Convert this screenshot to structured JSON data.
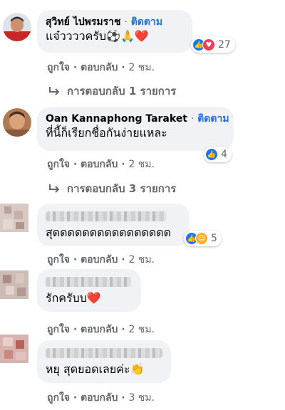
{
  "comments": [
    {
      "name": "สุวิทย์ ไปพรมราช",
      "follow": "ติดตาม",
      "text": "แจ๋ววววครับ⚽🙏❤️",
      "reactions": [
        "like",
        "love"
      ],
      "reaction_count": "27",
      "like_label": "ถูกใจ",
      "reply_label": "ตอบกลับ",
      "time": "2 ชม.",
      "replies_label": "การตอบกลับ 1 รายการ"
    },
    {
      "name": "Oan Kannaphong Taraket",
      "follow": "ติดตาม",
      "text": "ที่นี้ก็เรียกชื่อกันง่ายแหละ",
      "reactions": [
        "like"
      ],
      "reaction_count": "4",
      "like_label": "ถูกใจ",
      "reply_label": "ตอบกลับ",
      "time": "2 ชม.",
      "replies_label": "การตอบกลับ 3 รายการ"
    },
    {
      "name": "",
      "text": "สุดดดดดดดดดดดดดดดด",
      "reactions": [
        "like",
        "care"
      ],
      "reaction_count": "5",
      "like_label": "ถูกใจ",
      "reply_label": "ตอบกลับ",
      "time": "2 ชม."
    },
    {
      "name": "",
      "text": "รักครับบ❤️",
      "like_label": "ถูกใจ",
      "reply_label": "ตอบกลับ",
      "time": "2 ชม."
    },
    {
      "name": "",
      "text": "หยุ สุดยอดเลยค่ะ👏",
      "like_label": "ถูกใจ",
      "reply_label": "ตอบกลับ",
      "time": "3 ชม."
    }
  ],
  "separator": "·",
  "colors": {
    "bubble": "#f0f2f5",
    "link": "#216fdb",
    "muted": "#65676b",
    "like": "#1877f2",
    "love": "#f33e58"
  }
}
